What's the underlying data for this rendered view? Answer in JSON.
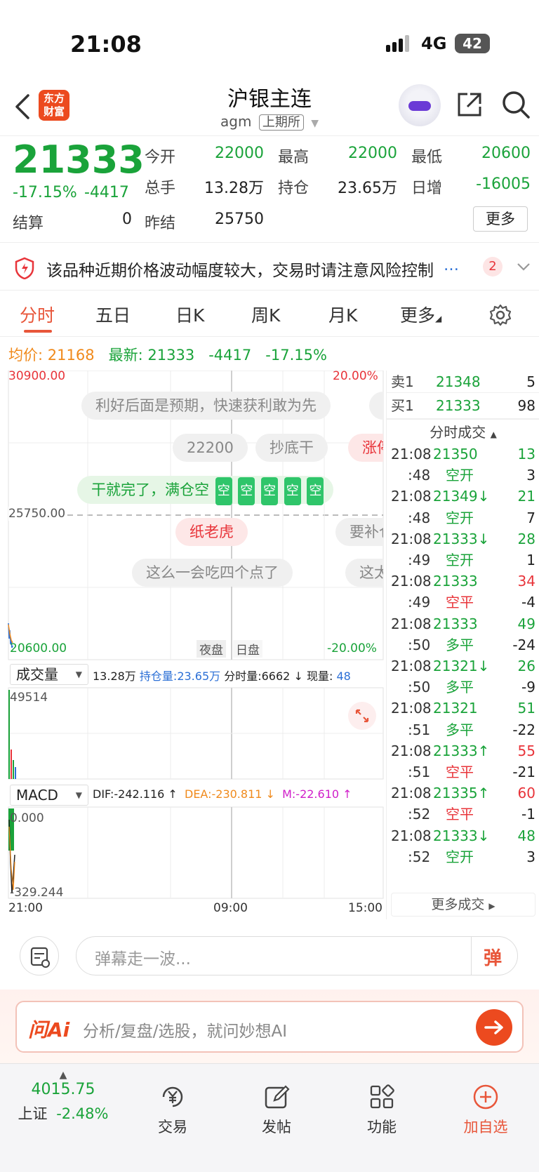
{
  "status_bar": {
    "time": "21:08",
    "network": "4G",
    "battery": "42"
  },
  "header": {
    "logo_line1": "东方",
    "logo_line2": "财富",
    "title": "沪银主连",
    "code": "agm",
    "exchange": "上期所"
  },
  "quote": {
    "price": "21333",
    "change_pct": "-17.15%",
    "change": "-4417",
    "fields": [
      {
        "label": "今开",
        "value": "22000",
        "color": "green"
      },
      {
        "label": "最高",
        "value": "22000",
        "color": "green"
      },
      {
        "label": "最低",
        "value": "20600",
        "color": "green"
      },
      {
        "label": "总手",
        "value": "13.28万",
        "color": "dark"
      },
      {
        "label": "持仓",
        "value": "23.65万",
        "color": "dark"
      },
      {
        "label": "日增",
        "value": "-16005",
        "color": "green"
      },
      {
        "label": "结算",
        "value": "0",
        "color": "dark"
      },
      {
        "label": "昨结",
        "value": "25750",
        "color": "dark"
      }
    ],
    "more_button": "更多"
  },
  "warning": {
    "text": "该品种近期价格波动幅度较大，交易时请注意风险控制",
    "badge": "2"
  },
  "tabs": [
    "分时",
    "五日",
    "日K",
    "周K",
    "月K",
    "更多"
  ],
  "info_line": {
    "avg_label": "均价:",
    "avg_value": "21168",
    "latest_label": "最新:",
    "latest_value": "21333",
    "change": "-4417",
    "change_pct": "-17.15%"
  },
  "chart": {
    "high_price": "30900.00",
    "high_pct": "20.00%",
    "mid_price": "25750.00",
    "low_price": "20600.00",
    "low_pct": "-20.00%",
    "session_night": "夜盘",
    "session_day": "日盘",
    "danmu": [
      "利好后面是预期，快速获利敢为先",
      "22200",
      "抄底干",
      "涨停",
      "干就完了，满仓空",
      "纸老虎",
      "要补仓",
      "这么一会吃四个点了",
      "这太"
    ],
    "danmu_icon": "空",
    "volume": {
      "selector": "成交量",
      "total": "13.28万",
      "oi_label": "持仓量:",
      "oi_value": "23.65万",
      "tick_label": "分时量:",
      "tick_value": "6662",
      "cur_label": "现量:",
      "cur_value": "48",
      "max": "49514"
    },
    "macd": {
      "selector": "MACD",
      "dif": "DIF:-242.116",
      "dea": "DEA:-230.811",
      "m": "M:-22.610",
      "top": "0.000",
      "bottom": "-329.244"
    },
    "time_axis": [
      "21:00",
      "09:00",
      "15:00"
    ]
  },
  "order_book": {
    "sell_label": "卖1",
    "sell_price": "21348",
    "sell_vol": "5",
    "buy_label": "买1",
    "buy_price": "21333",
    "buy_vol": "98",
    "ticks_header": "分时成交",
    "ticks": [
      {
        "time": "21:08",
        "price": "21350",
        "vol": "13",
        "vol_color": "green"
      },
      {
        "time": ":48",
        "price": "空开",
        "vol": "3",
        "price_color": "green",
        "vol_color": "dark"
      },
      {
        "time": "21:08",
        "price": "21349↓",
        "vol": "21",
        "vol_color": "green"
      },
      {
        "time": ":48",
        "price": "空开",
        "vol": "7",
        "price_color": "green",
        "vol_color": "dark"
      },
      {
        "time": "21:08",
        "price": "21333↓",
        "vol": "28",
        "vol_color": "green"
      },
      {
        "time": ":49",
        "price": "空开",
        "vol": "1",
        "price_color": "green",
        "vol_color": "dark"
      },
      {
        "time": "21:08",
        "price": "21333",
        "vol": "34",
        "vol_color": "red"
      },
      {
        "time": ":49",
        "price": "空平",
        "vol": "-4",
        "price_color": "red",
        "vol_color": "dark"
      },
      {
        "time": "21:08",
        "price": "21333",
        "vol": "49",
        "vol_color": "green"
      },
      {
        "time": ":50",
        "price": "多平",
        "vol": "-24",
        "price_color": "green",
        "vol_color": "dark"
      },
      {
        "time": "21:08",
        "price": "21321↓",
        "vol": "26",
        "vol_color": "green"
      },
      {
        "time": ":50",
        "price": "多平",
        "vol": "-9",
        "price_color": "green",
        "vol_color": "dark"
      },
      {
        "time": "21:08",
        "price": "21321",
        "vol": "51",
        "vol_color": "green"
      },
      {
        "time": ":51",
        "price": "多平",
        "vol": "-22",
        "price_color": "green",
        "vol_color": "dark"
      },
      {
        "time": "21:08",
        "price": "21333↑",
        "vol": "55",
        "vol_color": "red"
      },
      {
        "time": ":51",
        "price": "空平",
        "vol": "-21",
        "price_color": "red",
        "vol_color": "dark"
      },
      {
        "time": "21:08",
        "price": "21335↑",
        "vol": "60",
        "vol_color": "red"
      },
      {
        "time": ":52",
        "price": "空平",
        "vol": "-1",
        "price_color": "red",
        "vol_color": "dark"
      },
      {
        "time": "21:08",
        "price": "21333↓",
        "vol": "48",
        "vol_color": "green"
      },
      {
        "time": ":52",
        "price": "空开",
        "vol": "3",
        "price_color": "green",
        "vol_color": "dark"
      }
    ],
    "more_ticks": "更多成交"
  },
  "danmu_input": {
    "placeholder": "弹幕走一波...",
    "send_icon": "弹"
  },
  "ai_bar": {
    "brand": "问Ai",
    "placeholder": "分析/复盘/选股，就问妙想AI"
  },
  "bottom_nav": {
    "index_value": "4015.75",
    "index_name": "上证",
    "index_change": "-2.48%",
    "items": [
      "交易",
      "发帖",
      "功能",
      "加自选"
    ]
  }
}
